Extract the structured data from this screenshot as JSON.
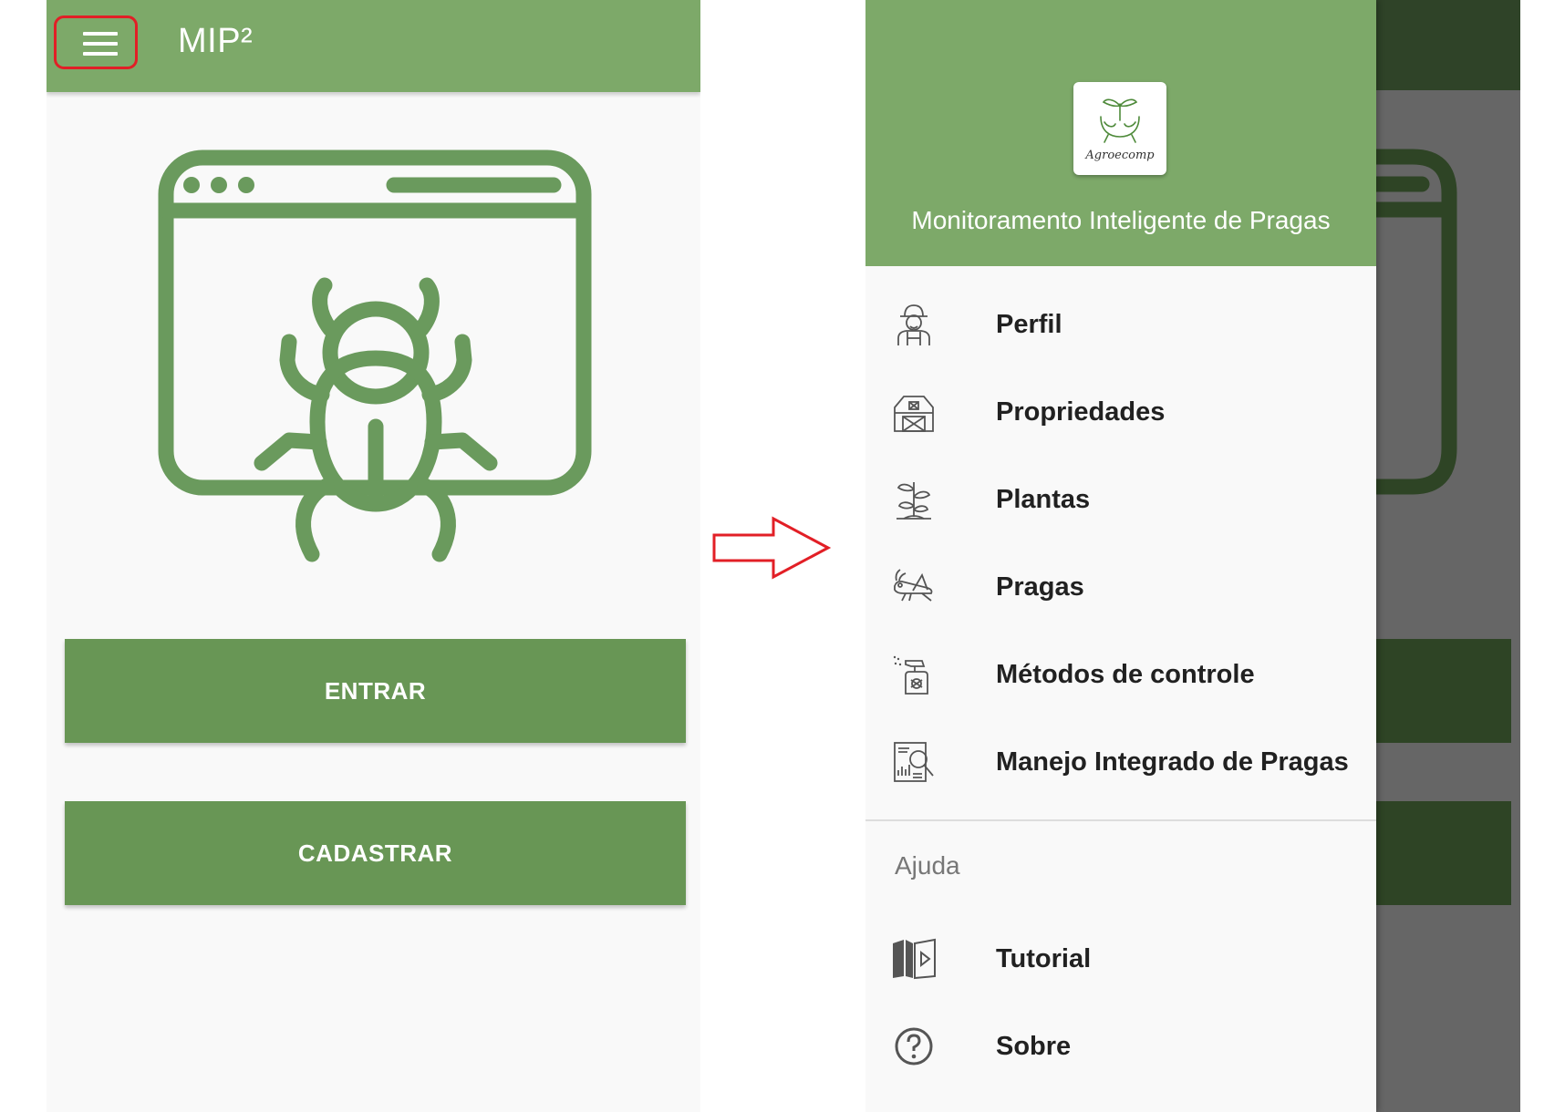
{
  "left_screen": {
    "app_title": "MIP²",
    "menu_icon": "hamburger-menu-icon",
    "hero_icon": "browser-bug-icon",
    "buttons": {
      "entrar": "ENTRAR",
      "cadastrar": "CADASTRAR"
    }
  },
  "arrow_icon": "right-arrow-icon",
  "drawer": {
    "logo_text": "Agroecomp",
    "subtitle": "Monitoramento Inteligente de Pragas",
    "items": [
      {
        "label": "Perfil",
        "icon": "farmer-icon"
      },
      {
        "label": "Propriedades",
        "icon": "barn-icon"
      },
      {
        "label": "Plantas",
        "icon": "plant-icon"
      },
      {
        "label": "Pragas",
        "icon": "grasshopper-icon"
      },
      {
        "label": "Métodos de controle",
        "icon": "spray-bottle-icon"
      },
      {
        "label": "Manejo Integrado de Pragas",
        "icon": "report-analysis-icon"
      }
    ],
    "help_section": {
      "title": "Ajuda",
      "items": [
        {
          "label": "Tutorial",
          "icon": "video-book-icon"
        },
        {
          "label": "Sobre",
          "icon": "question-circle-icon"
        }
      ]
    }
  },
  "colors": {
    "primary": "#7da969",
    "button": "#689655",
    "icon_green": "#6a9a5d",
    "highlight_red": "#e21f26",
    "scrim": "#666666",
    "background": "#f9f9f9"
  }
}
